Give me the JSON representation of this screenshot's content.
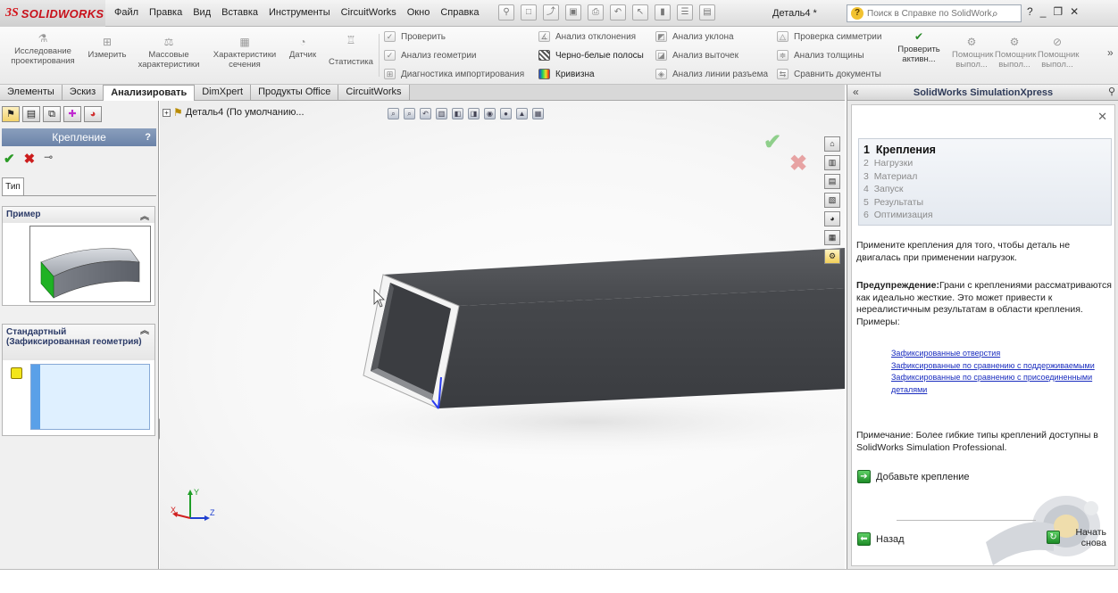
{
  "app": {
    "logo_ds": "3S",
    "logo_text": "SOLIDWORKS",
    "document_title": "Деталь4 *",
    "menus": [
      "Файл",
      "Правка",
      "Вид",
      "Вставка",
      "Инструменты",
      "CircuitWorks",
      "Окно",
      "Справка"
    ],
    "help_search_placeholder": "Поиск в Справке по SolidWorks"
  },
  "ribbon": {
    "big_buttons": [
      {
        "label": "Исследование проектирования",
        "icon": "design-study-icon"
      },
      {
        "label": "Измерить",
        "icon": "measure-icon"
      },
      {
        "label": "Массовые характеристики",
        "icon": "mass-properties-icon"
      },
      {
        "label": "Характеристики сечения",
        "icon": "section-properties-icon"
      },
      {
        "label": "Датчик",
        "icon": "sensor-icon"
      },
      {
        "label": "Статистика",
        "icon": "statistics-icon"
      }
    ],
    "small_col1": [
      "Проверить",
      "Анализ геометрии",
      "Диагностика импортирования"
    ],
    "small_col2": [
      "Анализ отклонения",
      "Черно-белые полосы",
      "Кривизна"
    ],
    "small_col3": [
      "Анализ уклона",
      "Анализ выточек",
      "Анализ линии разъема"
    ],
    "small_col4": [
      "Проверка симметрии",
      "Анализ толщины",
      "Сравнить документы"
    ],
    "check_active": "Проверить активн...",
    "help_buttons": [
      "Помощник выпол...",
      "Помощник выпол...",
      "Помощник выпол..."
    ]
  },
  "tabs": [
    "Элементы",
    "Эскиз",
    "Анализировать",
    "DimXpert",
    "Продукты Office",
    "CircuitWorks"
  ],
  "active_tab": "Анализировать",
  "property_manager": {
    "title": "Крепление",
    "help": "?",
    "type_tab": "Тип",
    "example_group": "Пример",
    "standard_group": "Стандартный (Зафиксированная геометрия)"
  },
  "viewport": {
    "tree_root": "Деталь4  (По умолчанию..."
  },
  "simulation": {
    "title": "SolidWorks SimulationXpress",
    "steps": [
      {
        "num": "1",
        "label": "Крепления"
      },
      {
        "num": "2",
        "label": "Нагрузки"
      },
      {
        "num": "3",
        "label": "Материал"
      },
      {
        "num": "4",
        "label": "Запуск"
      },
      {
        "num": "5",
        "label": "Результаты"
      },
      {
        "num": "6",
        "label": "Оптимизация"
      }
    ],
    "intro": "Примените крепления для того, чтобы деталь не двигалась при применении нагрузок.",
    "warning_label": "Предупреждение:",
    "warning_text": "Грани с креплениями рассматриваются как идеально жесткие. Это может привести к нереалистичным результатам в области крепления. Примеры:",
    "links": [
      "Зафиксированные отверстия",
      "Зафиксированные по сравнению с поддерживаемыми",
      "Зафиксированные по сравнению с присоединенными деталями"
    ],
    "note": "Примечание: Более гибкие типы креплений доступны в SolidWorks Simulation Professional.",
    "add_fixture": "Добавьте крепление",
    "back": "Назад",
    "restart": "Начать снова"
  },
  "colors": {
    "brand_red": "#d4141b",
    "pm_header": "#7890b3",
    "link_blue": "#1a2dbf",
    "fixed_face_green": "#1fb224",
    "beam_dark": "#3f4145"
  }
}
